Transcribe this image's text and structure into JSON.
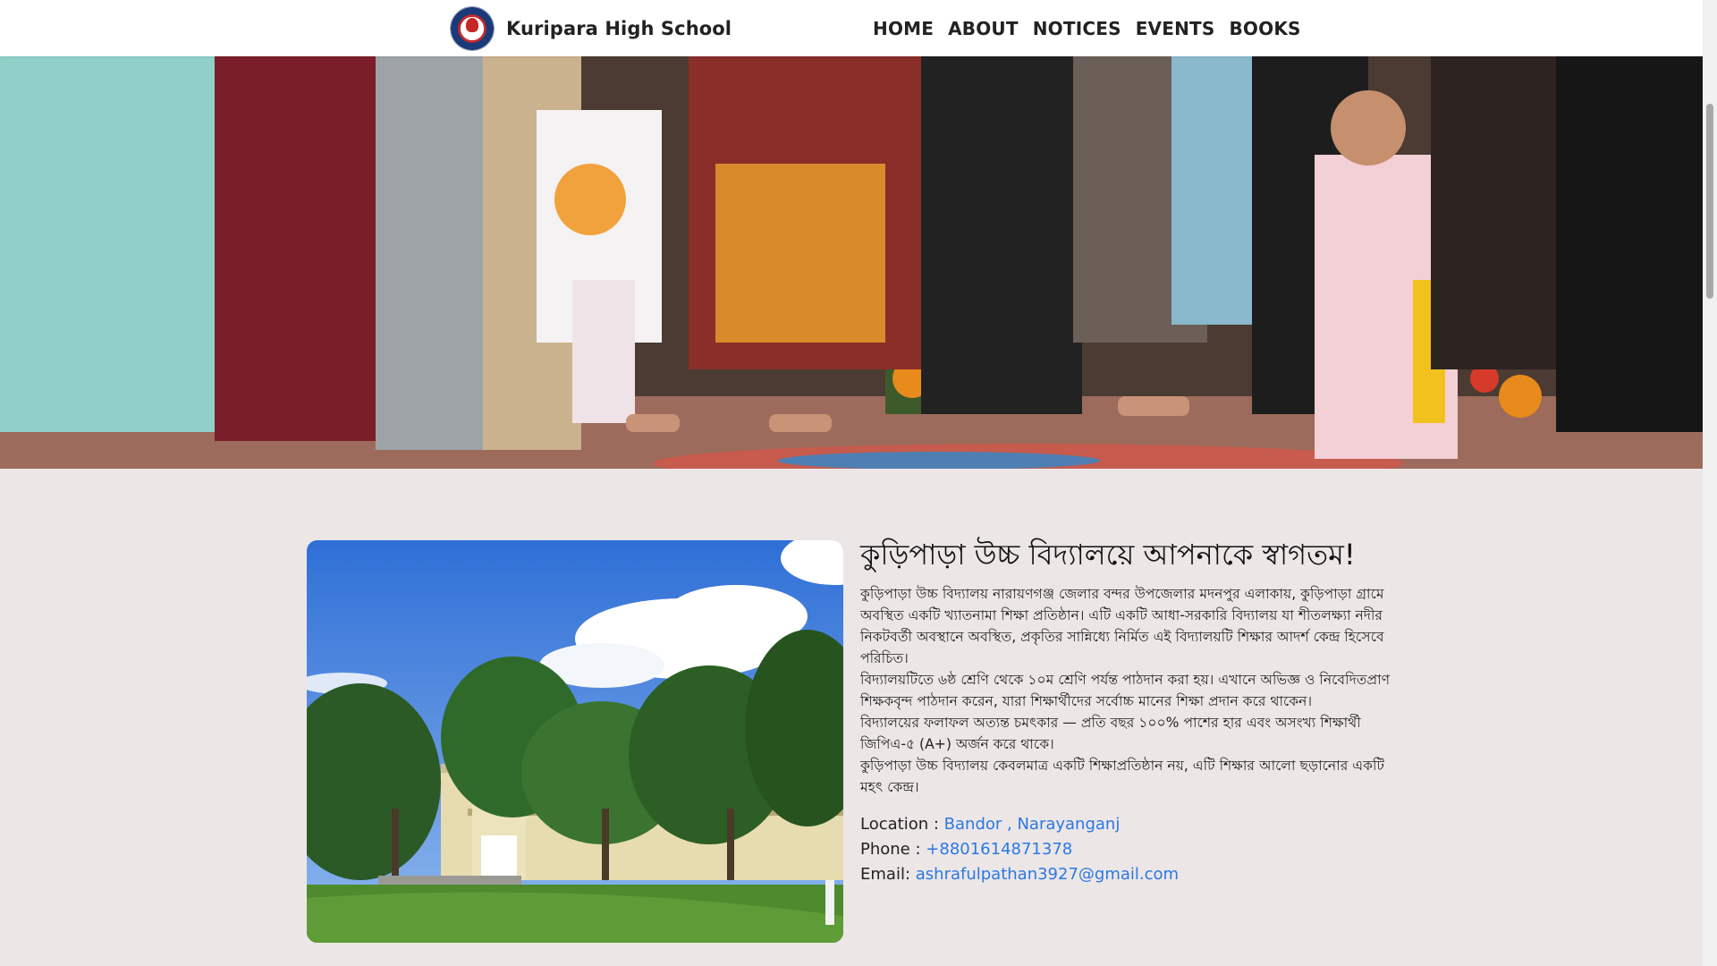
{
  "brand": {
    "name": "Kuripara High School"
  },
  "nav": {
    "items": [
      "HOME",
      "ABOUT",
      "NOTICES",
      "EVENTS",
      "BOOKS"
    ]
  },
  "welcome": {
    "title": "কুড়িপাড়া উচ্চ বিদ্যালয়ে আপনাকে স্বাগতম!",
    "paragraphs": [
      "কুড়িপাড়া উচ্চ বিদ্যালয় নারায়ণগঞ্জ জেলার বন্দর উপজেলার মদনপুর এলাকায়, কুড়িপাড়া গ্রামে অবস্থিত একটি খ্যাতনামা শিক্ষা প্রতিষ্ঠান। এটি একটি আধা-সরকারি বিদ্যালয় যা শীতলক্ষ্যা নদীর নিকটবর্তী অবস্থানে অবস্থিত, প্রকৃতির সান্নিধ্যে নির্মিত এই বিদ্যালয়টি শিক্ষার আদর্শ কেন্দ্র হিসেবে পরিচিত।",
      "বিদ্যালয়টিতে ৬ষ্ঠ শ্রেণি থেকে ১০ম শ্রেণি পর্যন্ত পাঠদান করা হয়। এখানে অভিজ্ঞ ও নিবেদিতপ্রাণ শিক্ষকবৃন্দ পাঠদান করেন, যারা শিক্ষার্থীদের সর্বোচ্চ মানের শিক্ষা প্রদান করে থাকেন।",
      "বিদ্যালয়ের ফলাফল অত্যন্ত চমৎকার — প্রতি বছর ১০০% পাশের হার এবং অসংখ্য শিক্ষার্থী জিপিএ-৫ (A+) অর্জন করে থাকে।",
      "কুড়িপাড়া উচ্চ বিদ্যালয় কেবলমাত্র একটি শিক্ষাপ্রতিষ্ঠান নয়, এটি শিক্ষার আলো ছড়ানোর একটি মহৎ কেন্দ্র।"
    ]
  },
  "contact": {
    "location_label": "Location :",
    "location_value": "Bandor , Narayanganj",
    "phone_label": "Phone :",
    "phone_value": "+8801614871378",
    "email_label": "Email:",
    "email_value": "ashrafulpathan3927@gmail.com"
  },
  "colors": {
    "link": "#2b78e4",
    "page_bg": "#ece6e6"
  }
}
